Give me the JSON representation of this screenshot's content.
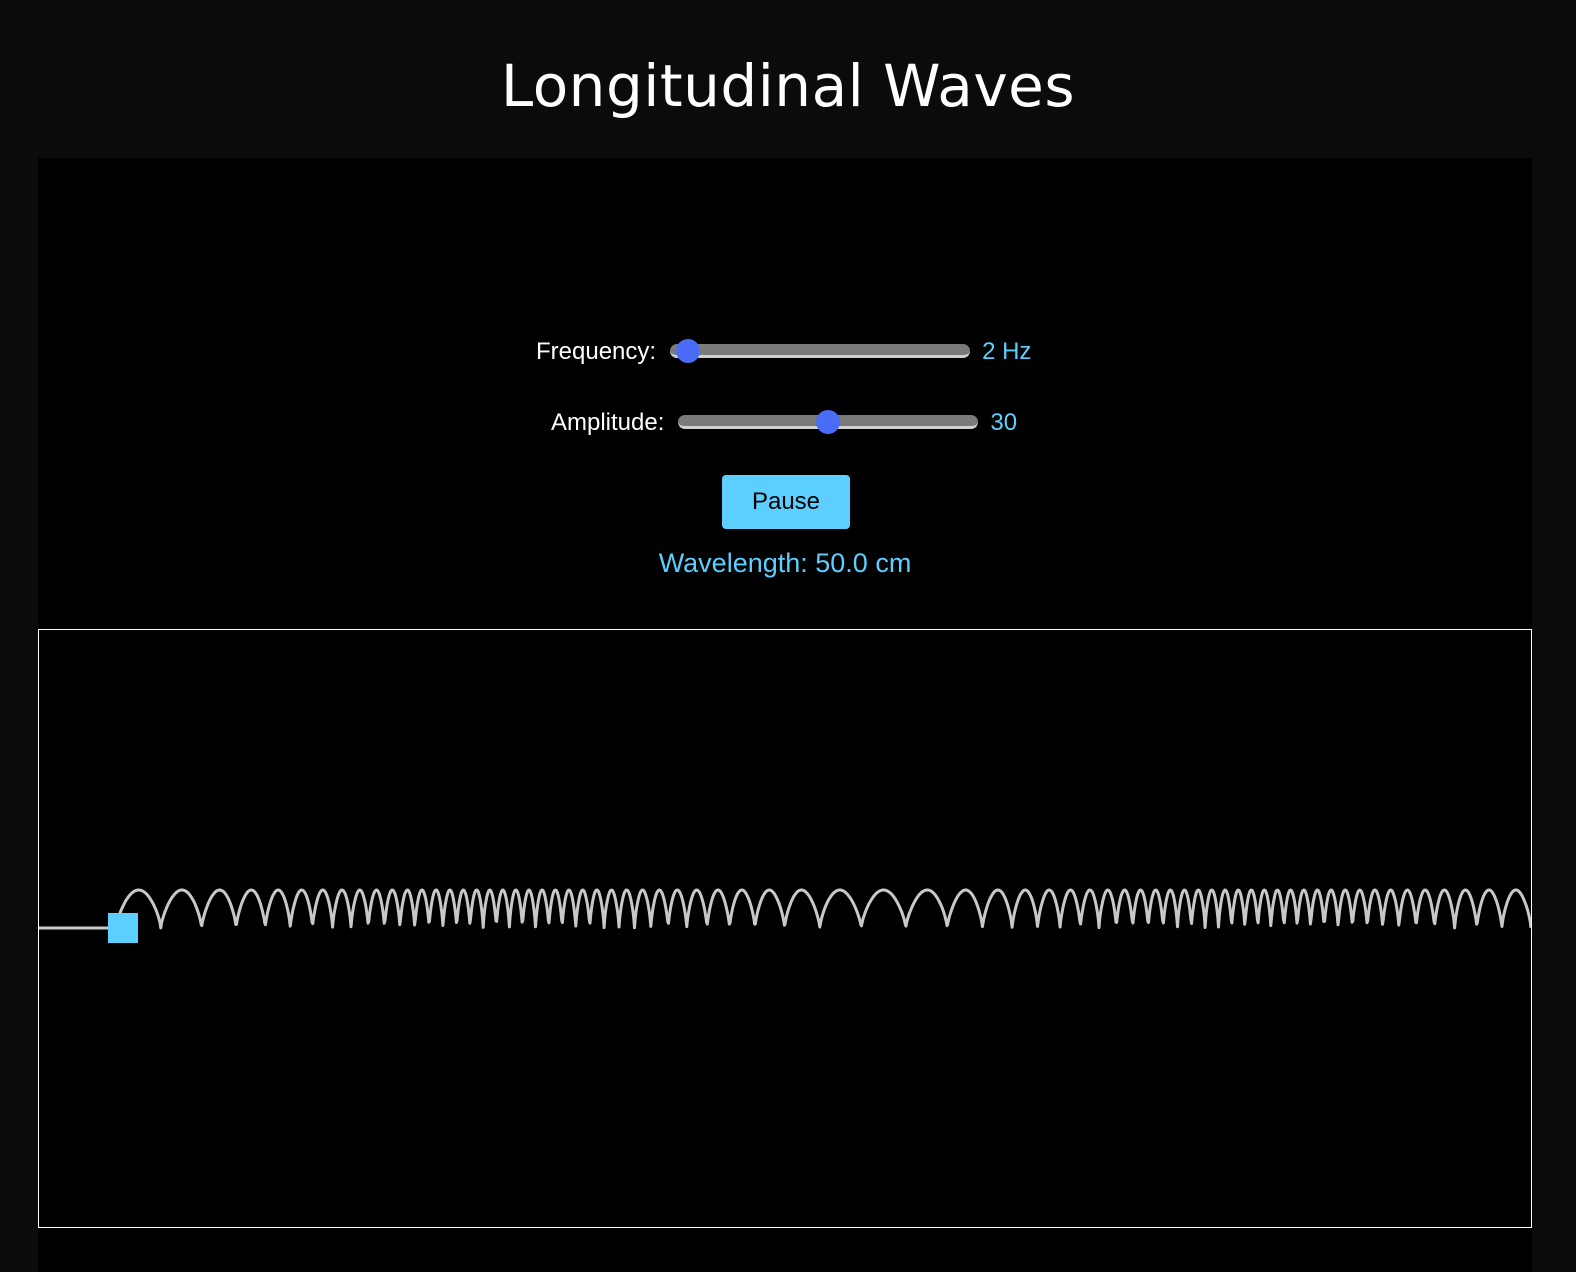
{
  "title": "Longitudinal Waves",
  "controls": {
    "frequency": {
      "label": "Frequency:",
      "value_text": "2 Hz",
      "value": 2,
      "slider_fraction": 0.02
    },
    "amplitude": {
      "label": "Amplitude:",
      "value_text": "30",
      "value": 30,
      "slider_fraction": 0.5
    },
    "pause_label": "Pause",
    "wavelength_text": "Wavelength: 50.0 cm"
  },
  "colors": {
    "accent": "#5ccfff",
    "slider_thumb": "#4a6cf7",
    "spring": "#c8c8c8",
    "background": "#000000"
  }
}
